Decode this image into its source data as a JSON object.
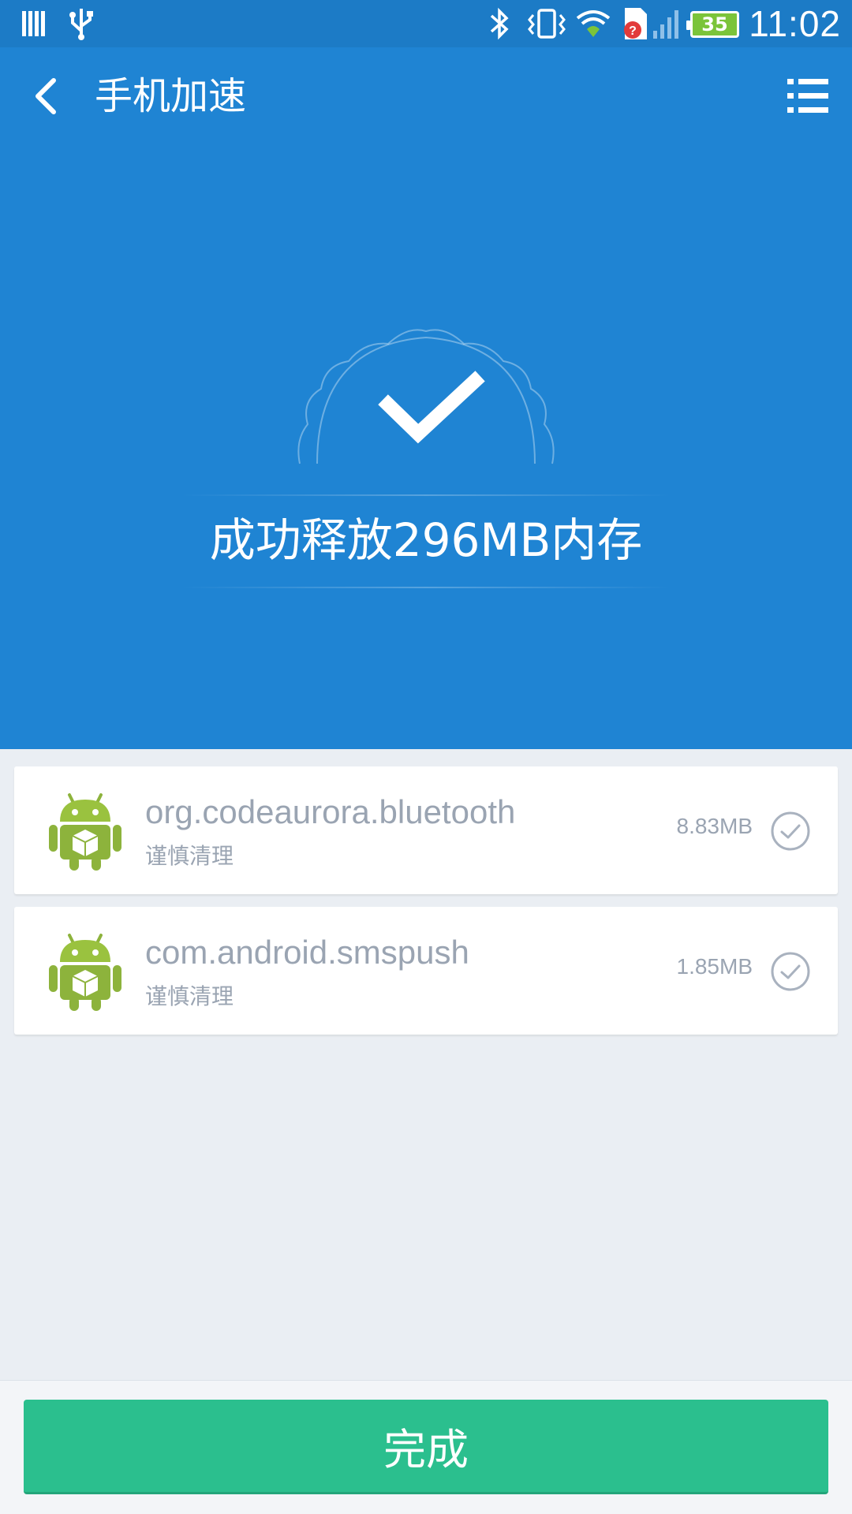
{
  "status_bar": {
    "time": "11:02",
    "battery_level": "35",
    "icons": [
      "notification-bars-icon",
      "usb-icon",
      "bluetooth-icon",
      "vibrate-icon",
      "wifi-icon",
      "sim-alert-icon",
      "signal-icon",
      "battery-icon"
    ]
  },
  "header": {
    "title": "手机加速",
    "back_icon": "back-arrow-icon",
    "menu_icon": "list-menu-icon"
  },
  "result": {
    "message": "成功释放296MB内存",
    "icon": "check-icon"
  },
  "apps": [
    {
      "package": "org.codeaurora.bluetooth",
      "label": "谨慎清理",
      "size": "8.83MB",
      "icon": "android-app-icon",
      "checked": true
    },
    {
      "package": "com.android.smspush",
      "label": "谨慎清理",
      "size": "1.85MB",
      "icon": "android-app-icon",
      "checked": true
    }
  ],
  "footer": {
    "done_label": "完成"
  },
  "colors": {
    "header_blue": "#1f84d3",
    "status_blue": "#1c7bc6",
    "done_green": "#2bbf8e",
    "list_background": "#eaeef3",
    "muted_text": "#9aa4b2",
    "battery_green": "#7bc43a"
  }
}
